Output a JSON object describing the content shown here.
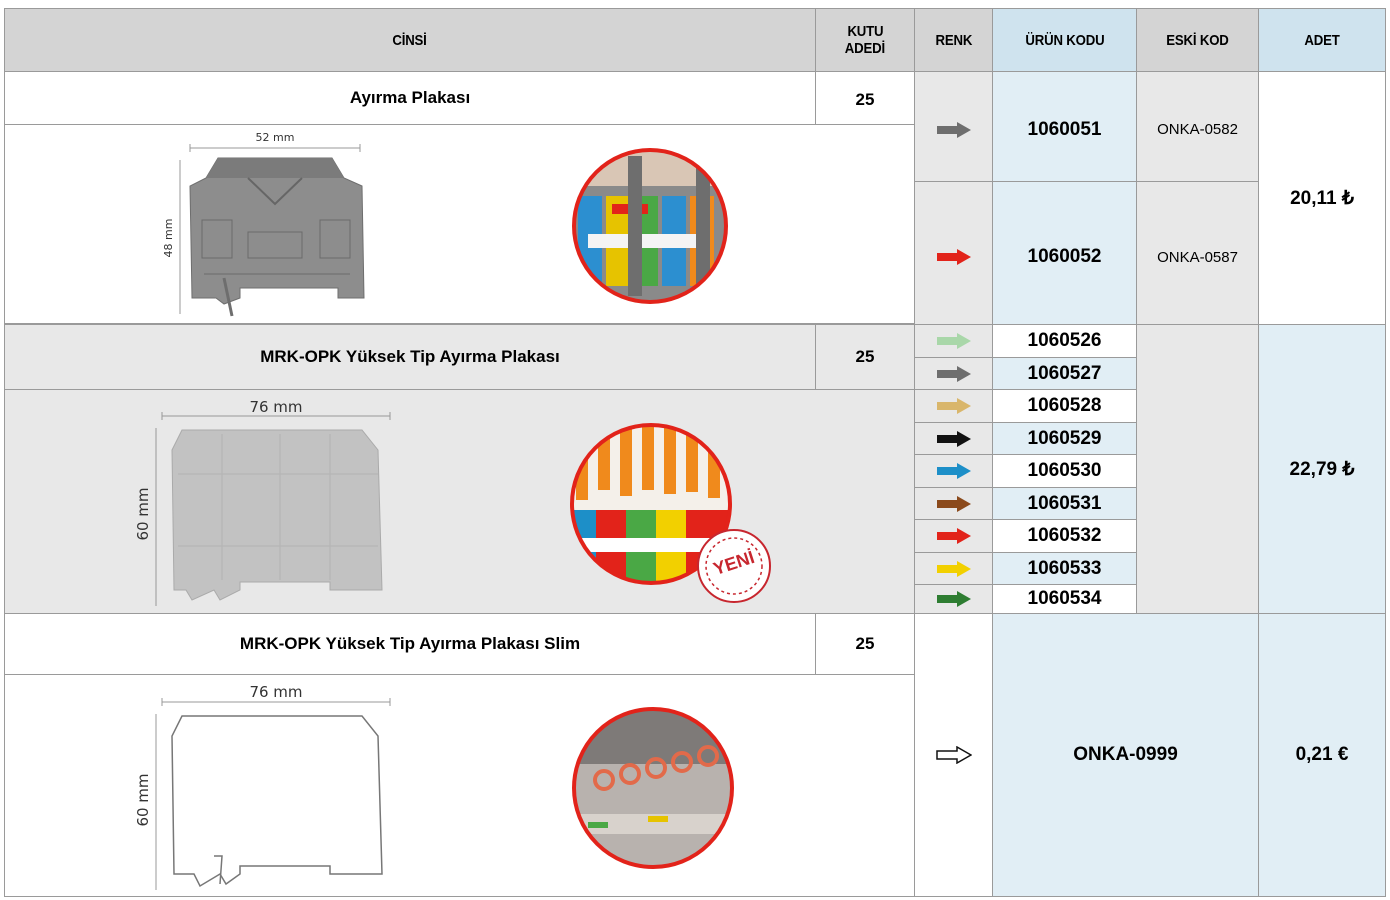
{
  "headers": {
    "cinsi": "CİNSİ",
    "kutu_line1": "KUTU",
    "kutu_line2": "ADEDİ",
    "renk": "RENK",
    "urun_kodu": "ÜRÜN KODU",
    "eski_kod": "ESKİ KOD",
    "adet": "ADET"
  },
  "products": [
    {
      "name": "Ayırma Plakası",
      "box_qty": "25",
      "width_label": "52 mm",
      "height_label": "48 mm",
      "price": "20,11 ₺",
      "variants": [
        {
          "color": "#6e6e6e",
          "code": "1060051",
          "old_code": "ONKA-0582"
        },
        {
          "color": "#e2231a",
          "code": "1060052",
          "old_code": "ONKA-0587"
        }
      ]
    },
    {
      "name": "MRK-OPK Yüksek Tip Ayırma Plakası",
      "box_qty": "25",
      "width_label": "76 mm",
      "height_label": "60 mm",
      "price": "22,79 ₺",
      "badge": "YENİ",
      "variants": [
        {
          "color": "#a9d7a9",
          "code": "1060526"
        },
        {
          "color": "#6e6e6e",
          "code": "1060527"
        },
        {
          "color": "#d9b66b",
          "code": "1060528"
        },
        {
          "color": "#111111",
          "code": "1060529"
        },
        {
          "color": "#1d8fc8",
          "code": "1060530"
        },
        {
          "color": "#8b4a1c",
          "code": "1060531"
        },
        {
          "color": "#e2231a",
          "code": "1060532"
        },
        {
          "color": "#f2d000",
          "code": "1060533"
        },
        {
          "color": "#2e7d32",
          "code": "1060534"
        }
      ]
    },
    {
      "name": "MRK-OPK Yüksek Tip Ayırma Plakası Slim",
      "box_qty": "25",
      "width_label": "76 mm",
      "height_label": "60 mm",
      "price": "0,21 €",
      "variants": [
        {
          "color": "#ffffff",
          "code": "ONKA-0999"
        }
      ]
    }
  ]
}
